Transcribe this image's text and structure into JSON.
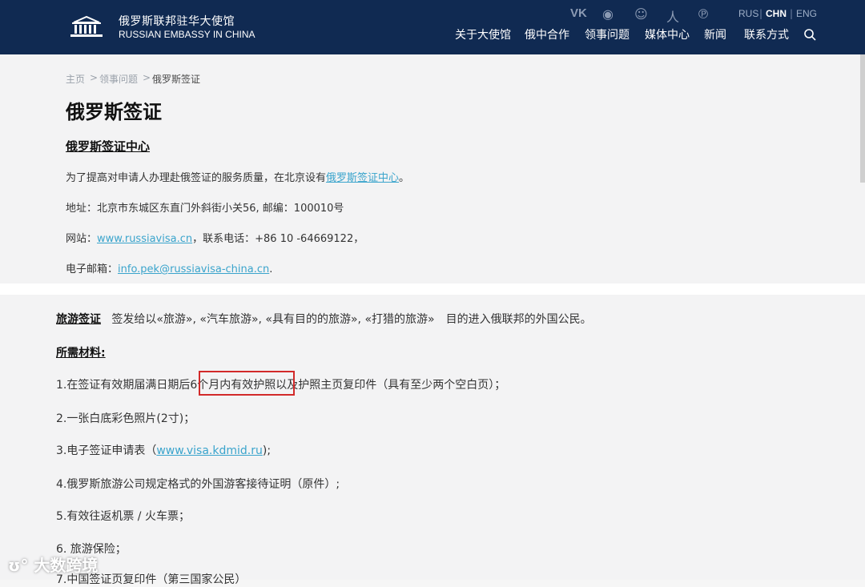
{
  "header": {
    "brand_cn": "俄罗斯联邦驻华大使馆",
    "brand_en": "RUSSIAN EMBASSY IN CHINA",
    "social_icons": [
      "vk-icon",
      "weibo-icon",
      "wechat-icon",
      "renren-icon",
      "douban-icon"
    ],
    "languages": [
      "RUS",
      "CHN",
      "ENG"
    ],
    "active_language": "CHN",
    "nav": [
      "关于大使馆",
      "俄中合作",
      "领事问题",
      "媒体中心",
      "新闻",
      "联系方式"
    ]
  },
  "breadcrumb": {
    "home": "主页",
    "sep1": ">",
    "section": "领事问题",
    "sep2": ">",
    "current": "俄罗斯签证"
  },
  "page": {
    "title": "俄罗斯签证",
    "subtitle": "俄罗斯签证中心",
    "intro_before": "为了提高对申请人办理赴俄签证的服务质量，在北京设有",
    "intro_link": "俄罗斯签证中心",
    "intro_after": "。",
    "address": "地址：北京市东城区东直门外斜街小关56, 邮编：100010号",
    "website_label": "网站：",
    "website_link": "www.russiavisa.cn",
    "phone_text": "，联系电话：+86 10 -64669122，",
    "email_label": "电子邮箱：",
    "email_link": "info.pek@russiavisa-china.cn",
    "email_after": "."
  },
  "visa": {
    "tag": "旅游签证",
    "desc": "签发给以«旅游», «汽车旅游», «具有目的的旅游», «打猎的旅游»　目的进入俄联邦的外国公民。",
    "materials_label": "所需材料:",
    "item1": "1.在签证有效期届满日期后6个月内有效护照以及护照主页复印件（具有至少两个空白页）；",
    "item2": "2.一张白底彩色照片(2寸)；",
    "item3_before": "3.电子签证申请表（",
    "item3_link": "www.visa.kdmid.ru",
    "item3_after": ");",
    "item4": "4.俄罗斯旅游公司规定格式的外国游客接待证明（原件）;",
    "item5": "5.有效往返机票 / 火车票；",
    "item6": "6. 旅游保险；",
    "item7": "7.中国签证页复印件（第三国家公民）"
  },
  "watermark": "大数跨境",
  "colors": {
    "header_bg": "#102a52",
    "link": "#3aa4cc",
    "highlight_box": "#d22a2a"
  }
}
